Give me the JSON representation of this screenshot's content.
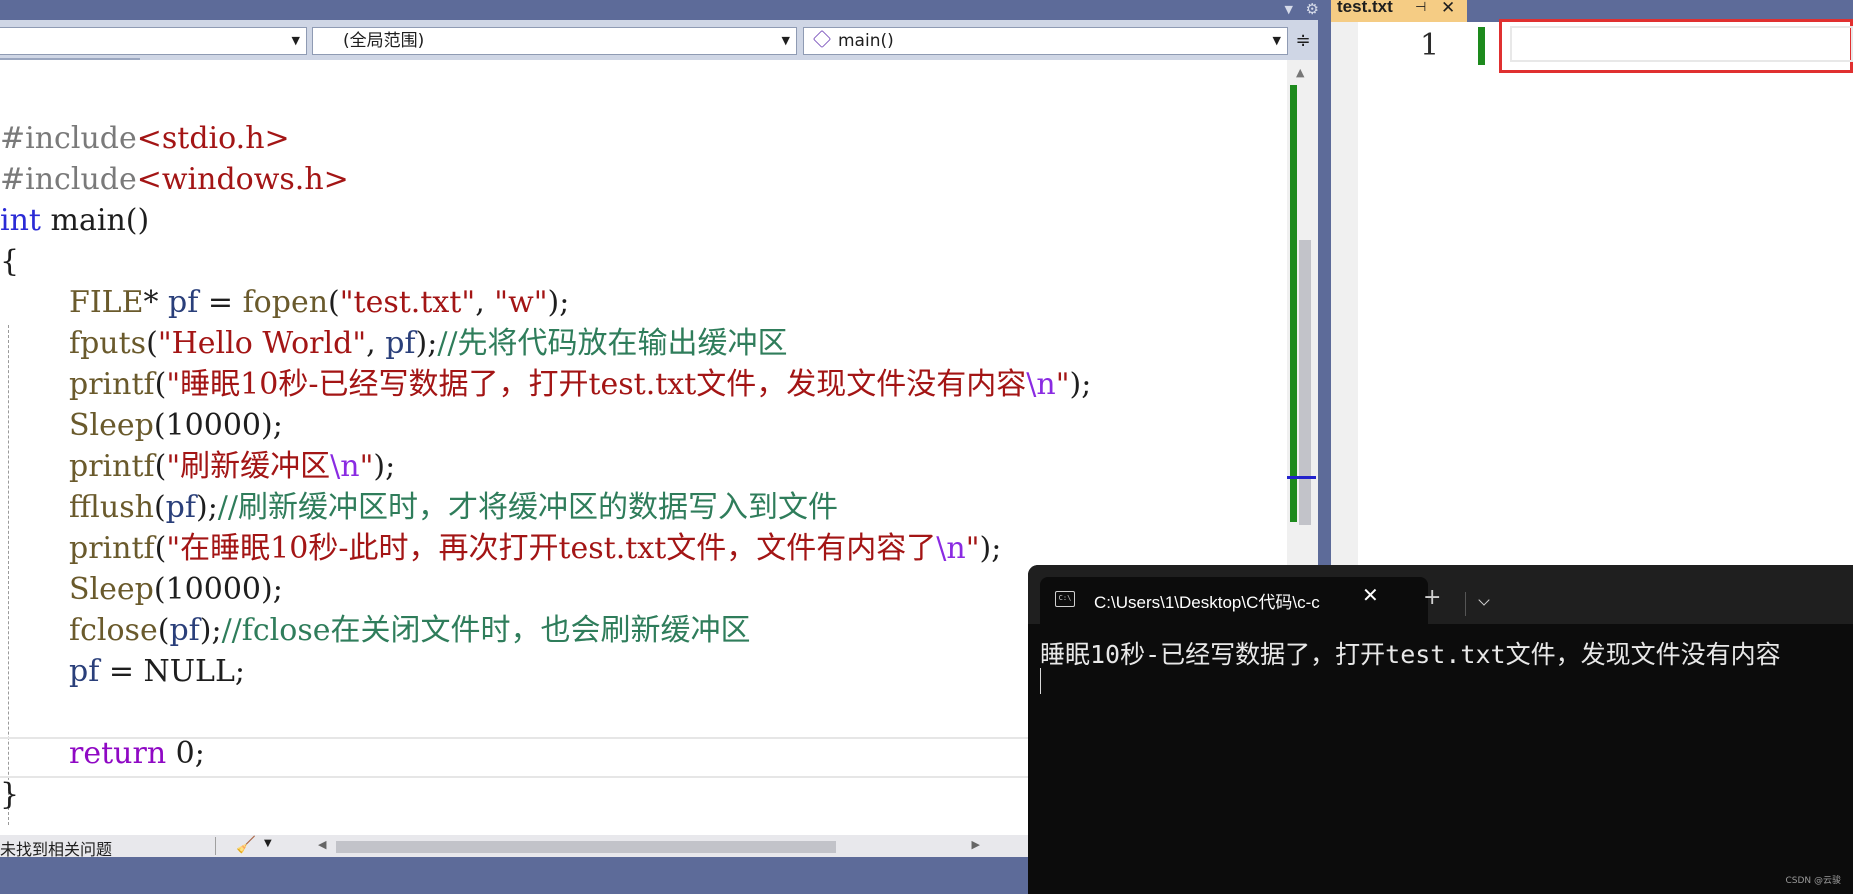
{
  "editor": {
    "nav": {
      "combo1_value": "",
      "combo2_value": "(全局范围)",
      "combo3_value": "main()"
    },
    "code": {
      "l1_a": "#include",
      "l1_b": "<stdio.h>",
      "l2_a": "#include",
      "l2_b": "<windows.h>",
      "l3_a": "int",
      "l3_b": " main()",
      "l4": "{",
      "l5_a": "FILE",
      "l5_b": "* ",
      "l5_c": "pf",
      "l5_d": " = ",
      "l5_e": "fopen",
      "l5_f": "(",
      "l5_g": "\"test.txt\"",
      "l5_h": ", ",
      "l5_i": "\"w\"",
      "l5_j": ");",
      "l6_a": "fputs",
      "l6_b": "(",
      "l6_c": "\"Hello World\"",
      "l6_d": ", ",
      "l6_e": "pf",
      "l6_f": ");",
      "l6_g": "//先将代码放在输出缓冲区",
      "l7_a": "printf",
      "l7_b": "(",
      "l7_c": "\"睡眠10秒-已经写数据了，打开test.txt文件，发现文件没有内容",
      "l7_d": "\\n",
      "l7_e": "\"",
      "l7_f": ");",
      "l8_a": "Sleep",
      "l8_b": "(10000);",
      "l9_a": "printf",
      "l9_b": "(",
      "l9_c": "\"刷新缓冲区",
      "l9_d": "\\n",
      "l9_e": "\"",
      "l9_f": ");",
      "l10_a": "fflush",
      "l10_b": "(",
      "l10_c": "pf",
      "l10_d": ");",
      "l10_e": "//刷新缓冲区时，才将缓冲区的数据写入到文件",
      "l11_a": "printf",
      "l11_b": "(",
      "l11_c": "\"在睡眠10秒-此时，再次打开test.txt文件，文件有内容了",
      "l11_d": "\\n",
      "l11_e": "\"",
      "l11_f": ");",
      "l12_a": "Sleep",
      "l12_b": "(10000);",
      "l13_a": "fclose",
      "l13_b": "(",
      "l13_c": "pf",
      "l13_d": ");",
      "l13_e": "//fclose在关闭文件时，也会刷新缓冲区",
      "l14_a": "pf",
      "l14_b": " = NULL;",
      "l16_a": "return",
      "l16_b": " 0;",
      "l17": "}"
    },
    "status_text": "未找到相关问题"
  },
  "document": {
    "tab_title": "test.txt",
    "line_number": "1",
    "content": ""
  },
  "terminal": {
    "tab_title": "C:\\Users\\1\\Desktop\\C代码\\c-c",
    "output_line": "睡眠10秒-已经写数据了，打开test.txt文件，发现文件没有内容",
    "watermark": "CSDN @云骏"
  },
  "colors": {
    "ide_frame": "#5d6b99",
    "tab_active": "#f5cc84",
    "string": "#a31515",
    "comment": "#2f7d5b",
    "keyword": "#2b2bd6",
    "change_bar": "#1d8a1d",
    "highlight_box": "#e03030",
    "terminal_bg": "#0c0c0c"
  },
  "icons": [
    "settings-gear-icon",
    "dropdown-arrow-icon",
    "scope-icon",
    "method-cube-icon",
    "split-window-icon",
    "broom-icon",
    "pin-icon",
    "close-icon",
    "terminal-app-icon",
    "new-tab-plus-icon",
    "chevron-down-icon"
  ]
}
